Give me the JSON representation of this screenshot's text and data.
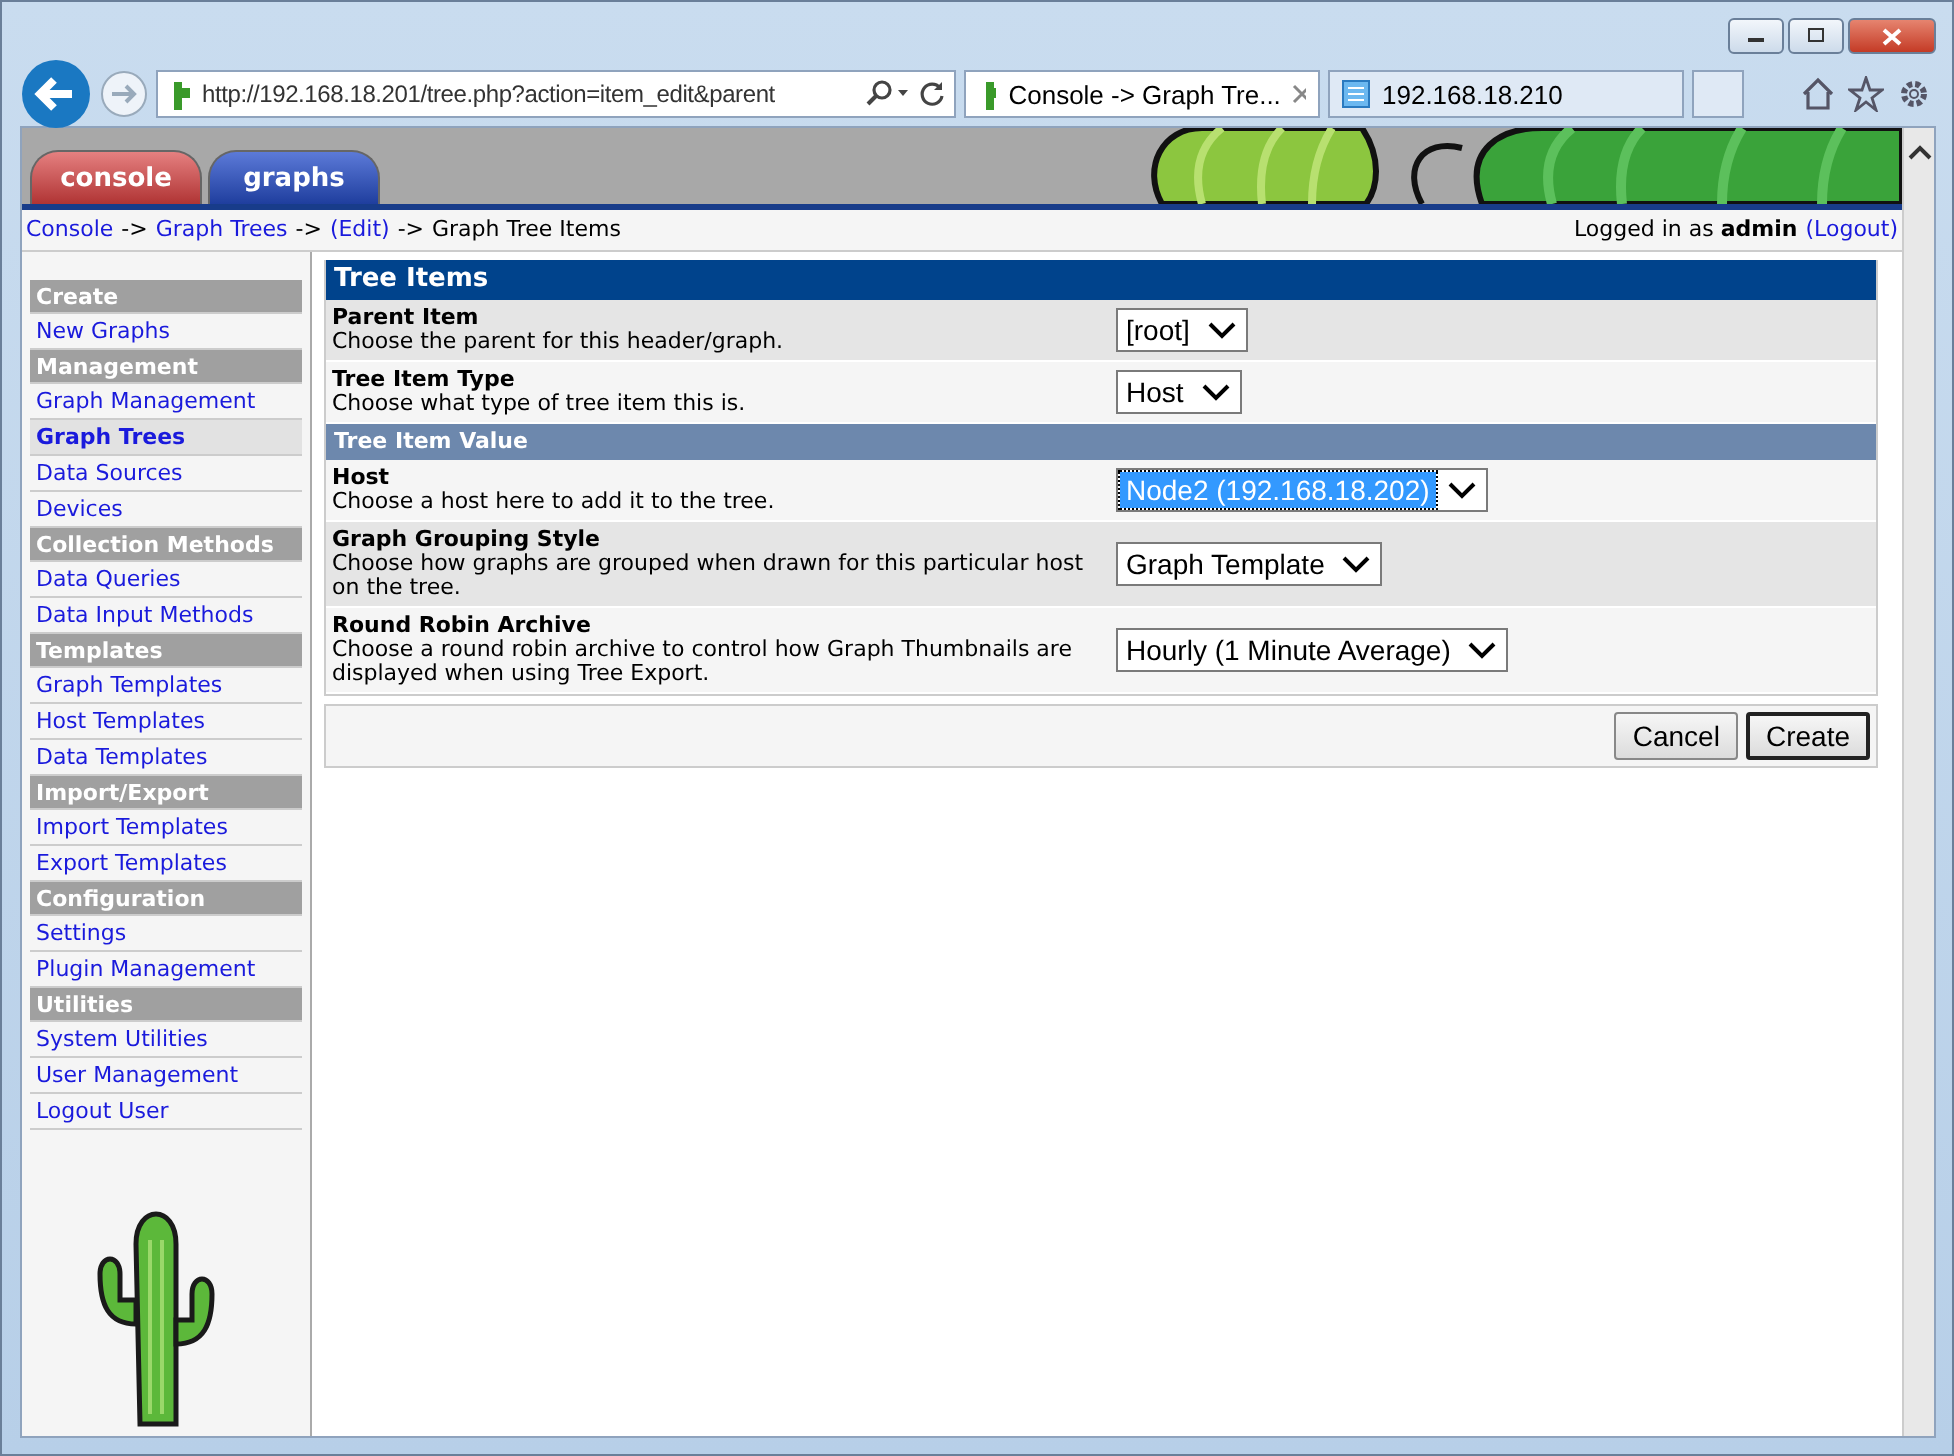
{
  "browser": {
    "address": "http://192.168.18.201/tree.php?action=item_edit&parent",
    "tabs": [
      {
        "label": "Console -> Graph Tre...",
        "selected": true
      },
      {
        "label": "192.168.18.210",
        "selected": false
      }
    ]
  },
  "header_tabs": [
    {
      "label": "console",
      "selected": true
    },
    {
      "label": "graphs",
      "selected": false
    }
  ],
  "breadcrumb": [
    {
      "text": "Console",
      "kind": "link"
    },
    {
      "text": "->",
      "kind": "text"
    },
    {
      "text": "Graph Trees",
      "kind": "link"
    },
    {
      "text": "->",
      "kind": "text"
    },
    {
      "text": "(Edit)",
      "kind": "link"
    },
    {
      "text": "->",
      "kind": "text"
    },
    {
      "text": "Graph Tree Items",
      "kind": "text"
    }
  ],
  "login": {
    "prefix": "Logged in as",
    "user": "admin",
    "logout": "(Logout)"
  },
  "sidebar": [
    {
      "header": "Create",
      "items": [
        {
          "label": "New Graphs",
          "selected": false
        }
      ]
    },
    {
      "header": "Management",
      "items": [
        {
          "label": "Graph Management",
          "selected": false
        },
        {
          "label": "Graph Trees",
          "selected": true
        },
        {
          "label": "Data Sources",
          "selected": false
        },
        {
          "label": "Devices",
          "selected": false
        }
      ]
    },
    {
      "header": "Collection Methods",
      "items": [
        {
          "label": "Data Queries",
          "selected": false
        },
        {
          "label": "Data Input Methods",
          "selected": false
        }
      ]
    },
    {
      "header": "Templates",
      "items": [
        {
          "label": "Graph Templates",
          "selected": false
        },
        {
          "label": "Host Templates",
          "selected": false
        },
        {
          "label": "Data Templates",
          "selected": false
        }
      ]
    },
    {
      "header": "Import/Export",
      "items": [
        {
          "label": "Import Templates",
          "selected": false
        },
        {
          "label": "Export Templates",
          "selected": false
        }
      ]
    },
    {
      "header": "Configuration",
      "items": [
        {
          "label": "Settings",
          "selected": false
        },
        {
          "label": "Plugin Management",
          "selected": false
        }
      ]
    },
    {
      "header": "Utilities",
      "items": [
        {
          "label": "System Utilities",
          "selected": false
        },
        {
          "label": "User Management",
          "selected": false
        },
        {
          "label": "Logout User",
          "selected": false
        }
      ]
    }
  ],
  "form": {
    "title": "Tree Items",
    "rows": [
      {
        "kind": "field",
        "label": "Parent Item",
        "description": "Choose the parent for this header/graph.",
        "value": "[root]",
        "focused": false
      },
      {
        "kind": "field",
        "label": "Tree Item Type",
        "description": "Choose what type of tree item this is.",
        "value": "Host",
        "focused": false
      },
      {
        "kind": "subheader",
        "label": "Tree Item Value"
      },
      {
        "kind": "field",
        "label": "Host",
        "description": "Choose a host here to add it to the tree.",
        "value": "Node2 (192.168.18.202)",
        "focused": true
      },
      {
        "kind": "field",
        "label": "Graph Grouping Style",
        "description": "Choose how graphs are grouped when drawn for this particular host on the tree.",
        "value": "Graph Template",
        "focused": false
      },
      {
        "kind": "field",
        "label": "Round Robin Archive",
        "description": "Choose a round robin archive to control how Graph Thumbnails are displayed when using Tree Export.",
        "value": "Hourly (1 Minute Average)",
        "focused": false
      }
    ],
    "buttons": [
      {
        "label": "Cancel",
        "default": false
      },
      {
        "label": "Create",
        "default": true
      }
    ]
  }
}
